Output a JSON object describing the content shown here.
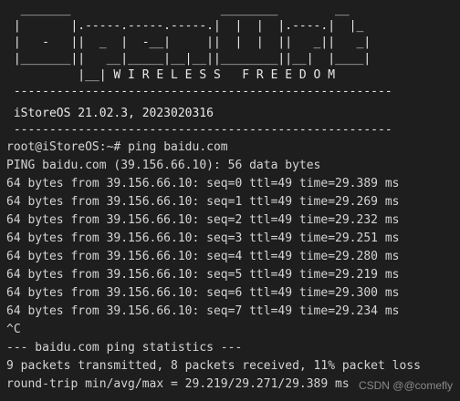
{
  "banner": {
    "ascii": [
      "  _______                     ________        __",
      " |       |.-----.-----.-----.|  |  |  |.----.|  |_",
      " |   -   ||  _  |  -__|     ||  |  |  ||   _||   _|",
      " |_______||   __|_____|__|__||________||__|  |____|",
      "          |__| W I R E L E S S   F R E E D O M"
    ],
    "divider": " -----------------------------------------------------",
    "os_version": " iStoreOS 21.02.3, 2023020316",
    "divider2": " -----------------------------------------------------"
  },
  "session": {
    "prompt": "root@iStoreOS:~# ",
    "command": "ping baidu.com",
    "lines": [
      "PING baidu.com (39.156.66.10): 56 data bytes",
      "64 bytes from 39.156.66.10: seq=0 ttl=49 time=29.389 ms",
      "64 bytes from 39.156.66.10: seq=1 ttl=49 time=29.269 ms",
      "64 bytes from 39.156.66.10: seq=2 ttl=49 time=29.232 ms",
      "64 bytes from 39.156.66.10: seq=3 ttl=49 time=29.251 ms",
      "64 bytes from 39.156.66.10: seq=4 ttl=49 time=29.280 ms",
      "64 bytes from 39.156.66.10: seq=5 ttl=49 time=29.219 ms",
      "64 bytes from 39.156.66.10: seq=6 ttl=49 time=29.300 ms",
      "64 bytes from 39.156.66.10: seq=7 ttl=49 time=29.234 ms",
      "^C",
      "--- baidu.com ping statistics ---",
      "9 packets transmitted, 8 packets received, 11% packet loss",
      "round-trip min/avg/max = 29.219/29.271/29.389 ms"
    ]
  },
  "watermark": "CSDN @@comefly",
  "colors": {
    "background": "#1e1e1e",
    "text": "#d4d4d4"
  }
}
